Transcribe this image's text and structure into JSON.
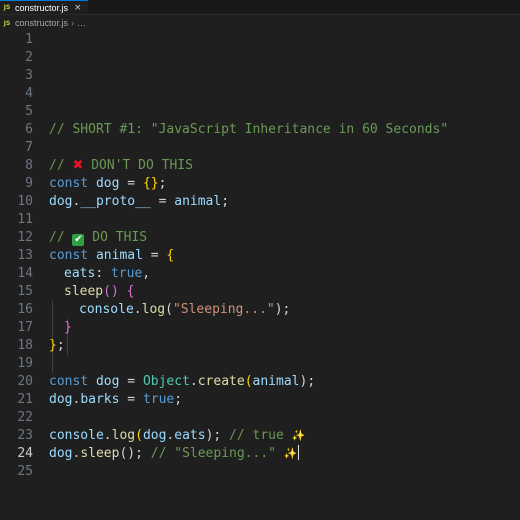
{
  "tab": {
    "icon": "JS",
    "label": "constructor.js",
    "close": "×"
  },
  "breadcrumb": {
    "icon": "JS",
    "file": "constructor.js",
    "sep": "›",
    "more": "…"
  },
  "editor": {
    "line_numbers": [
      "1",
      "2",
      "3",
      "4",
      "5",
      "6",
      "7",
      "8",
      "9",
      "10",
      "11",
      "12",
      "13",
      "14",
      "15",
      "16",
      "17",
      "18",
      "19",
      "20",
      "21",
      "22",
      "23",
      "24",
      "25"
    ],
    "active_line": "24",
    "lines": {
      "l6": "// SHORT #1: \"JavaScript Inheritance in 60 Seconds\"",
      "l8_a": "// ",
      "l8_b": " DON'T DO THIS",
      "l8_emoji": "✖",
      "l9": [
        "const",
        " ",
        "dog",
        " = ",
        "{}",
        ";"
      ],
      "l10": [
        "dog",
        ".",
        "__proto__",
        " = ",
        "animal",
        ";"
      ],
      "l12_a": "// ",
      "l12_emoji": "✔",
      "l12_b": " DO THIS",
      "l13": [
        "const",
        " ",
        "animal",
        " = ",
        "{"
      ],
      "l14": [
        "eats",
        ": ",
        "true",
        ","
      ],
      "l15": [
        "sleep",
        "() ",
        "{"
      ],
      "l16": [
        "console",
        ".",
        "log",
        "(",
        "\"Sleeping...\"",
        ");"
      ],
      "l17": "}",
      "l18": [
        "}",
        ";"
      ],
      "l20": [
        "const",
        " ",
        "dog",
        " = ",
        "Object",
        ".",
        "create",
        "(",
        "animal",
        ");"
      ],
      "l21": [
        "dog",
        ".",
        "barks",
        " = ",
        "true",
        ";"
      ],
      "l23": [
        "console",
        ".",
        "log",
        "(",
        "dog",
        ".",
        "eats",
        "); ",
        "// true ",
        "✨"
      ],
      "l24": [
        "dog",
        ".",
        "sleep",
        "(); ",
        "// \"Sleeping...\" ",
        "✨"
      ]
    }
  }
}
